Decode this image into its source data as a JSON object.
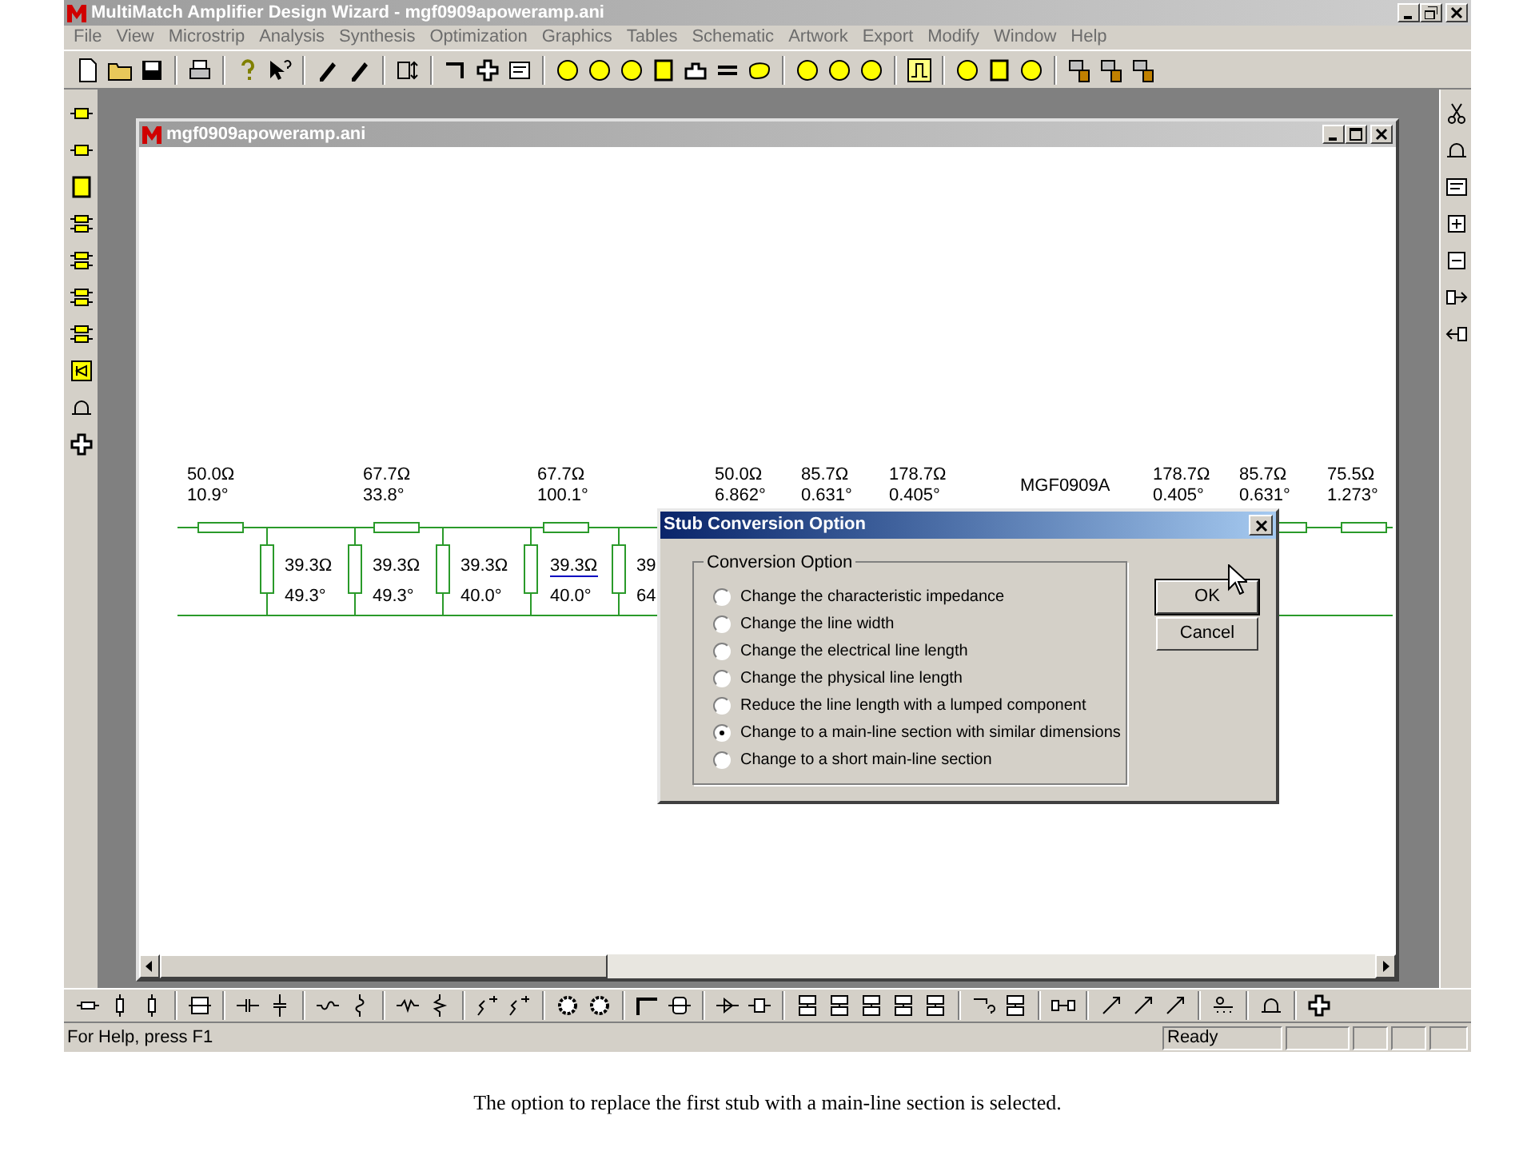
{
  "window": {
    "title": "MultiMatch Amplifier Design Wizard - mgf0909apoweramp.ani"
  },
  "menu": [
    "File",
    "View",
    "Microstrip",
    "Analysis",
    "Synthesis",
    "Optimization",
    "Graphics",
    "Tables",
    "Schematic",
    "Artwork",
    "Export",
    "Modify",
    "Window",
    "Help"
  ],
  "document": {
    "title": "mgf0909apoweramp.ani",
    "series": [
      {
        "impedance": "50.0Ω",
        "angle": "10.9°"
      },
      {
        "impedance": "67.7Ω",
        "angle": "33.8°"
      },
      {
        "impedance": "67.7Ω",
        "angle": "100.1°"
      },
      {
        "impedance": "50.0Ω",
        "angle": "6.862°"
      },
      {
        "impedance": "85.7Ω",
        "angle": "0.631°"
      },
      {
        "impedance": "178.7Ω",
        "angle": "0.405°"
      },
      {
        "impedance": "178.7Ω",
        "angle": "0.405°"
      },
      {
        "impedance": "85.7Ω",
        "angle": "0.631°"
      },
      {
        "impedance": "75.5Ω",
        "angle": "1.273°"
      }
    ],
    "device": "MGF0909A",
    "stubs": [
      {
        "impedance": "39.3Ω",
        "angle": "49.3°",
        "selected": false
      },
      {
        "impedance": "39.3Ω",
        "angle": "49.3°",
        "selected": false
      },
      {
        "impedance": "39.3Ω",
        "angle": "40.0°",
        "selected": false
      },
      {
        "impedance": "39.3Ω",
        "angle": "40.0°",
        "selected": true
      },
      {
        "impedance": "39",
        "angle": "64",
        "selected": false
      }
    ]
  },
  "dialog": {
    "title": "Stub Conversion Option",
    "group": "Conversion Option",
    "options": [
      {
        "label": "Change the characteristic impedance",
        "selected": false
      },
      {
        "label": "Change the line width",
        "selected": false
      },
      {
        "label": "Change the electrical line length",
        "selected": false
      },
      {
        "label": "Change the physical line length",
        "selected": false
      },
      {
        "label": "Reduce the line length with a lumped component",
        "selected": false
      },
      {
        "label": "Change to a main-line section with similar dimensions",
        "selected": true
      },
      {
        "label": "Change to a short main-line section",
        "selected": false
      }
    ],
    "buttons": [
      "OK",
      "Cancel"
    ]
  },
  "status_bar": {
    "help": "For Help, press F1",
    "state": "Ready"
  },
  "caption": "The option to replace the first stub with a main-line section is selected."
}
